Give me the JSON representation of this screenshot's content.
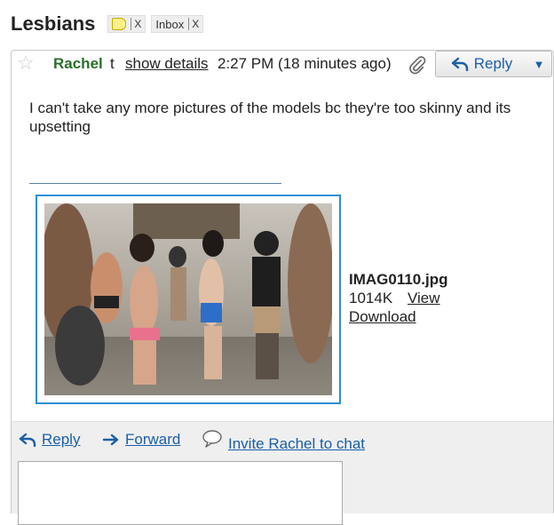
{
  "subject": {
    "title": "Lesbians",
    "labels": [
      {
        "text": "",
        "remove": "X"
      },
      {
        "text": "Inbox",
        "remove": "X"
      }
    ]
  },
  "message": {
    "sender": "Rachel",
    "sender_rest": "t",
    "show_details": "show details",
    "time": "2:27 PM (18 minutes ago)",
    "reply_label": "Reply",
    "more_symbol": "▼",
    "body": "I can't take any more pictures of the models bc they're too skinny and its upsetting",
    "attachment": {
      "filename": "IMAG0110.jpg",
      "size": "1014K",
      "view": "View",
      "download": "Download"
    }
  },
  "footer": {
    "reply": "Reply",
    "forward": "Forward",
    "invite": "Invite Rachel to chat"
  },
  "colors": {
    "sender": "#2a6e2a",
    "link": "#1a5fa8",
    "attachment_border": "#2b8fd6"
  },
  "icons": [
    "star-icon",
    "paperclip-icon",
    "reply-arrow-icon",
    "dropdown-arrow-icon",
    "forward-arrow-icon",
    "chat-bubble-icon",
    "label-tag-icon"
  ]
}
